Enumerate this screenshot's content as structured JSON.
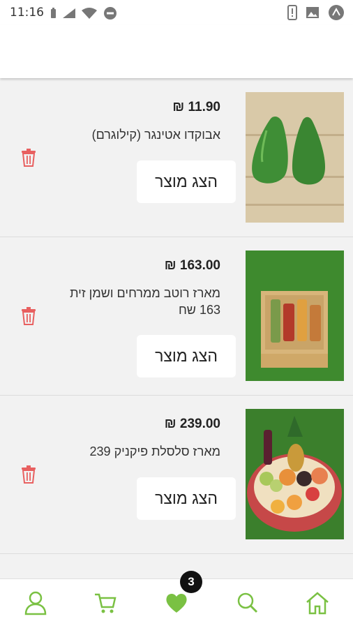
{
  "status_bar": {
    "time": "11:16"
  },
  "colors": {
    "accent": "#7ac143",
    "trash": "#e86060"
  },
  "cart": {
    "items": [
      {
        "price": "11.90 ₪",
        "name": "אבוקדו אטינגר (קילוגרם)",
        "button_label": "הצג מוצר",
        "image_icon": "avocado-image"
      },
      {
        "price": "163.00 ₪",
        "name": "מארז רוטב ממרחים ושמן זית 163 שח",
        "button_label": "הצג מוצר",
        "image_icon": "spreads-box-image"
      },
      {
        "price": "239.00 ₪",
        "name": "מארז סלסלת פיקניק 239",
        "button_label": "הצג מוצר",
        "image_icon": "picnic-basket-image"
      }
    ]
  },
  "bottom_nav": {
    "favorites_badge": "3",
    "icons": [
      "user-icon",
      "cart-icon",
      "heart-icon",
      "search-icon",
      "home-icon"
    ]
  }
}
